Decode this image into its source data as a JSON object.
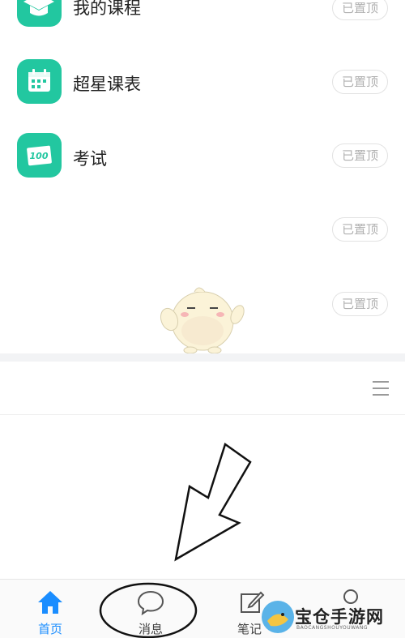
{
  "menu_items": [
    {
      "label": "我的课程",
      "pin_label": "已置顶",
      "icon": "graduation-cap-icon"
    },
    {
      "label": "超星课表",
      "pin_label": "已置顶",
      "icon": "calendar-icon"
    },
    {
      "label": "考试",
      "pin_label": "已置顶",
      "icon": "score-100-icon"
    },
    {
      "label": "",
      "pin_label": "已置顶",
      "icon": ""
    },
    {
      "label": "",
      "pin_label": "已置顶",
      "icon": ""
    }
  ],
  "toolbar": {
    "menu_icon": "hamburger-menu-icon"
  },
  "tabbar": {
    "tabs": [
      {
        "label": "首页",
        "icon": "home-icon",
        "active": true
      },
      {
        "label": "消息",
        "icon": "chat-bubble-icon",
        "active": false
      },
      {
        "label": "笔记",
        "icon": "edit-note-icon",
        "active": false
      }
    ]
  },
  "colors": {
    "accent": "#22c7a0",
    "active_tab": "#1a8dff",
    "pin_border": "#e2e2e2"
  },
  "watermark": {
    "title": "宝仓手游网",
    "subtitle": "BAOCANGSHOUYOUWANG"
  }
}
